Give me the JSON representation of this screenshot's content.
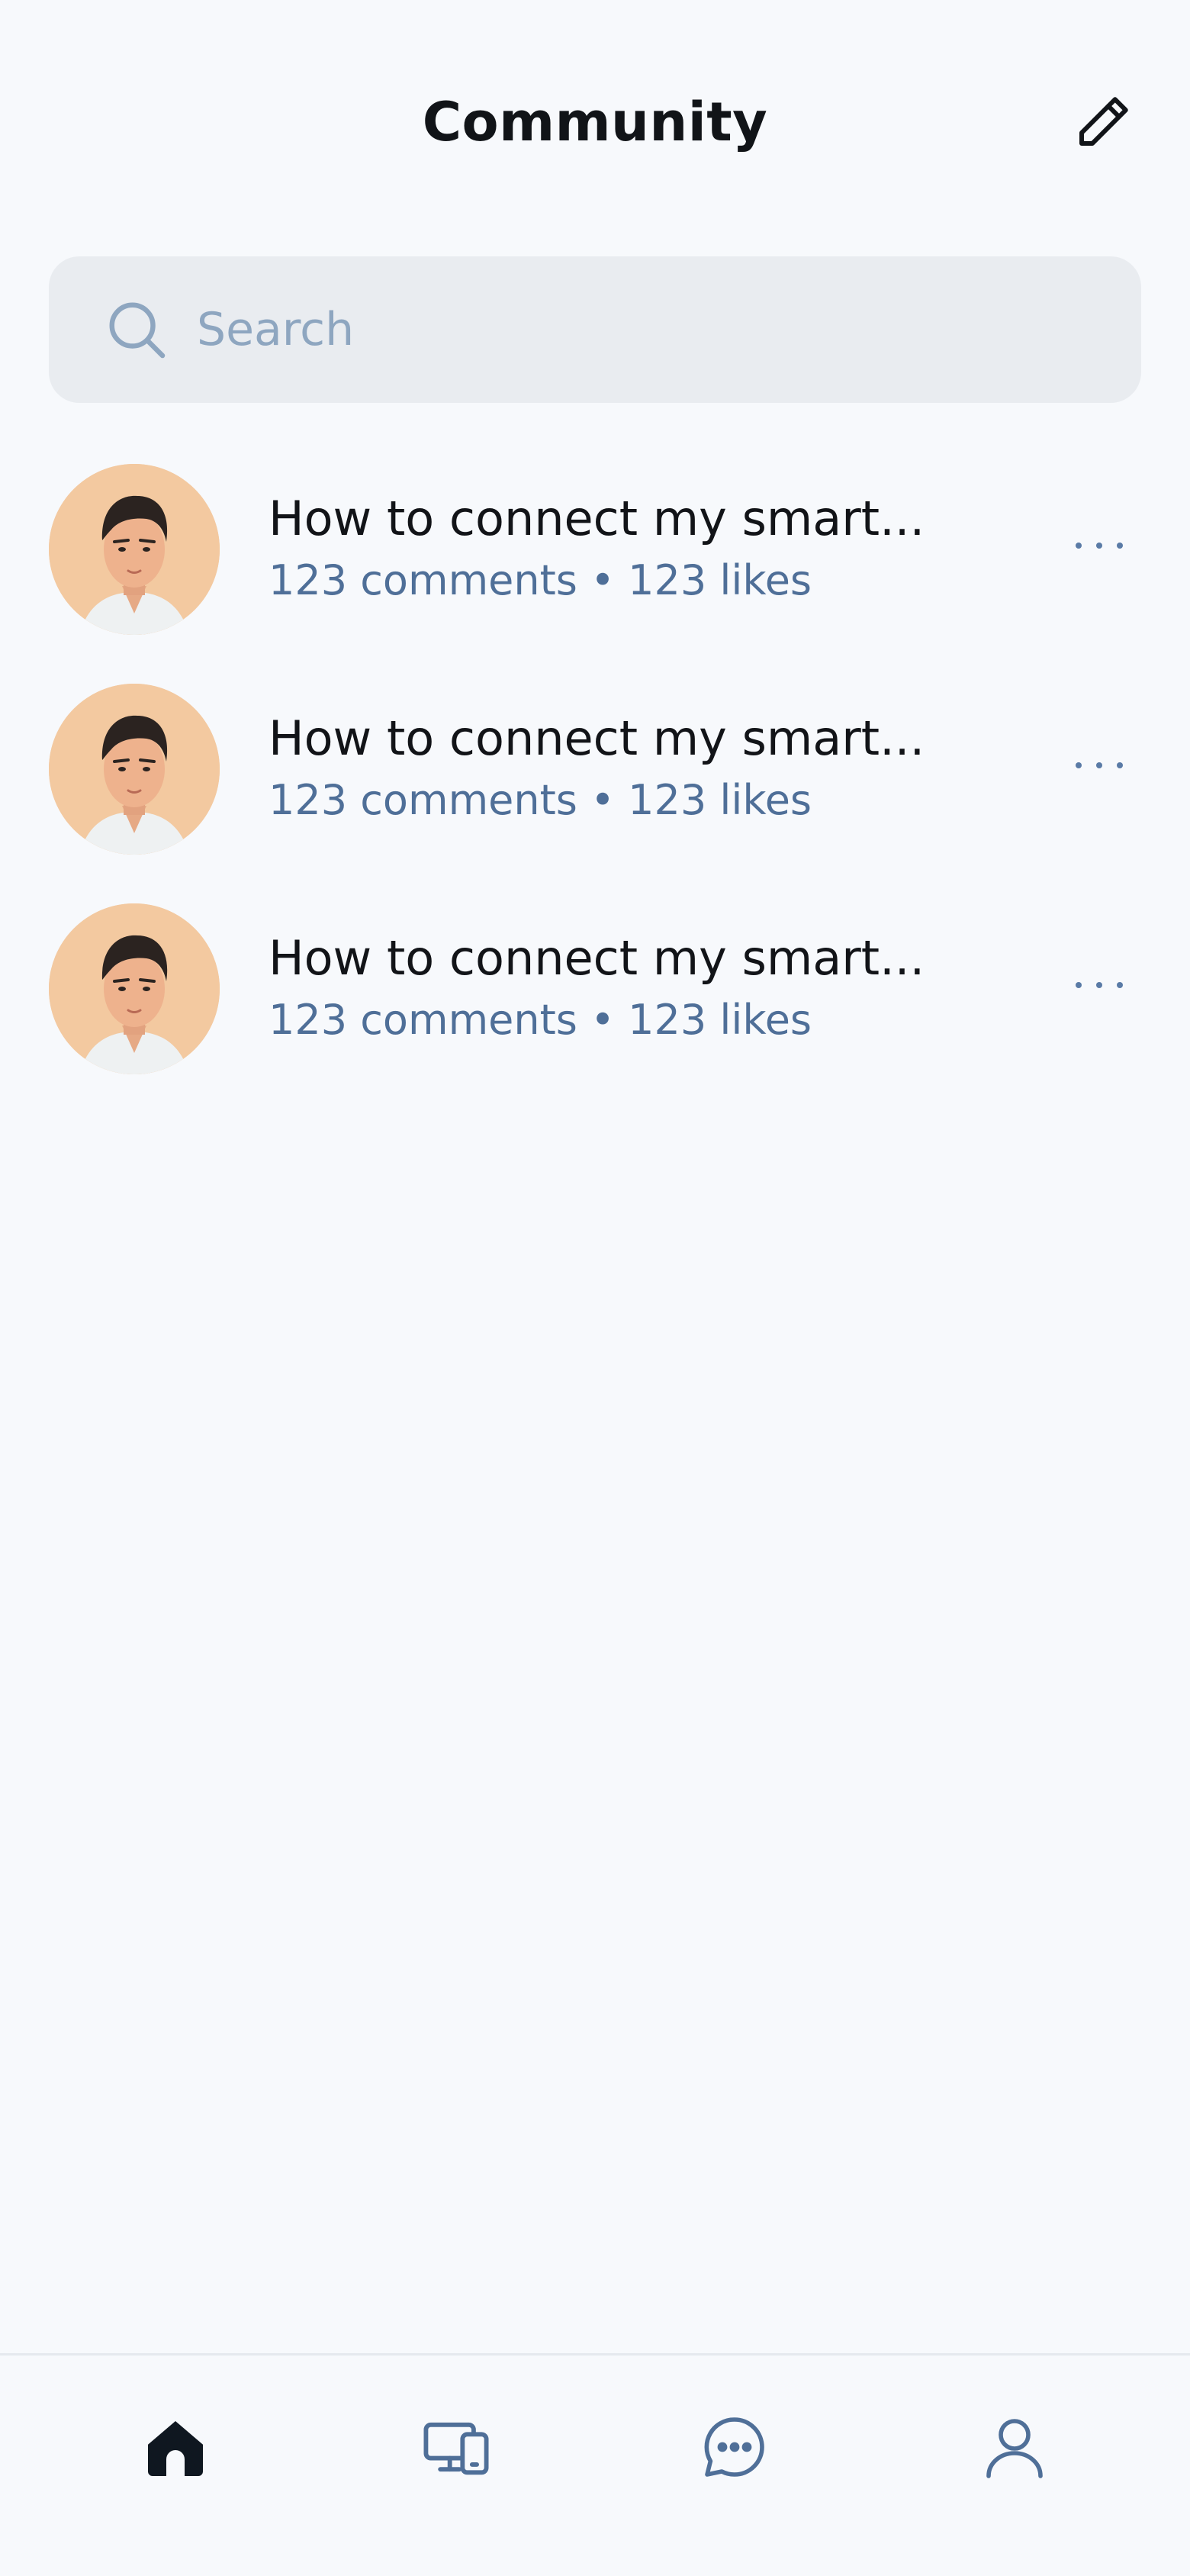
{
  "header": {
    "title": "Community",
    "edit_icon": "pencil-icon"
  },
  "search": {
    "placeholder": "Search",
    "value": "",
    "icon": "search-icon"
  },
  "posts": [
    {
      "title": "How to connect my smart...",
      "comments": "123 comments",
      "separator": "•",
      "likes": "123 likes",
      "menu_icon": "more-horizontal-icon"
    },
    {
      "title": "How to connect my smart...",
      "comments": "123 comments",
      "separator": "•",
      "likes": "123 likes",
      "menu_icon": "more-horizontal-icon"
    },
    {
      "title": "How to connect my smart...",
      "comments": "123 comments",
      "separator": "•",
      "likes": "123 likes",
      "menu_icon": "more-horizontal-icon"
    }
  ],
  "tabbar": {
    "items": [
      {
        "icon": "home-icon",
        "active": true
      },
      {
        "icon": "devices-icon",
        "active": false
      },
      {
        "icon": "chat-icon",
        "active": false
      },
      {
        "icon": "profile-icon",
        "active": false
      }
    ]
  },
  "colors": {
    "background": "#f7f9fc",
    "search_background": "#e9ecf0",
    "primary_text": "#121418",
    "secondary_text": "#4f6f98",
    "placeholder": "#8ea6c0",
    "accent_dark": "#0f1720",
    "avatar_background": "#f3c9a0"
  }
}
